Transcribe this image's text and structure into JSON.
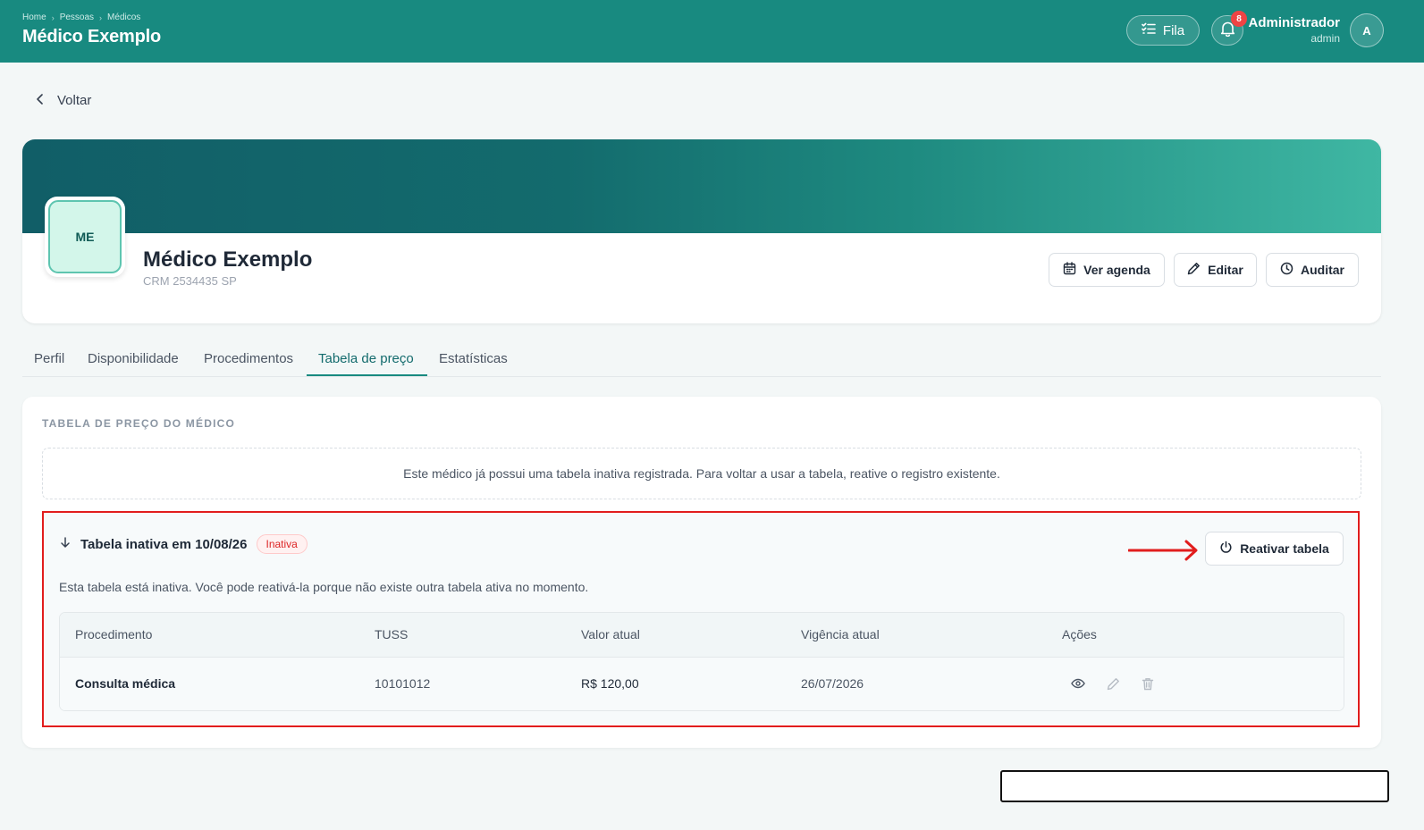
{
  "header": {
    "breadcrumb": [
      "Home",
      "Pessoas",
      "Médicos"
    ],
    "title": "Médico Exemplo",
    "queue_label": "Fila",
    "notification_count": "8",
    "user_name": "Administrador",
    "user_role": "admin",
    "avatar_initial": "A"
  },
  "back_label": "Voltar",
  "profile": {
    "initials": "ME",
    "name": "Médico Exemplo",
    "crm": "CRM 2534435 SP",
    "actions": {
      "schedule": "Ver agenda",
      "edit": "Editar",
      "audit": "Auditar"
    }
  },
  "tabs": [
    {
      "label": "Perfil",
      "active": false
    },
    {
      "label": "Disponibilidade",
      "active": false
    },
    {
      "label": "Procedimentos",
      "active": false
    },
    {
      "label": "Tabela de preço",
      "active": true
    },
    {
      "label": "Estatísticas",
      "active": false
    }
  ],
  "price_section": {
    "title": "TABELA DE PREÇO DO MÉDICO",
    "notice": "Este médico já possui uma tabela inativa registrada. Para voltar a usar a tabela, reative o registro existente.",
    "inactive_table": {
      "heading": "Tabela inativa em 10/08/26",
      "status": "Inativa",
      "reactivate_label": "Reativar tabela",
      "description": "Esta tabela está inativa. Você pode reativá-la porque não existe outra tabela ativa no momento.",
      "columns": [
        "Procedimento",
        "TUSS",
        "Valor atual",
        "Vigência atual",
        "Ações"
      ],
      "rows": [
        {
          "procedure": "Consulta médica",
          "tuss": "10101012",
          "value": "R$ 120,00",
          "validity": "26/07/2026"
        }
      ]
    }
  },
  "colors": {
    "brand": "#188a80",
    "highlight": "#e11d1d",
    "status_inactive": "#dc2626"
  }
}
